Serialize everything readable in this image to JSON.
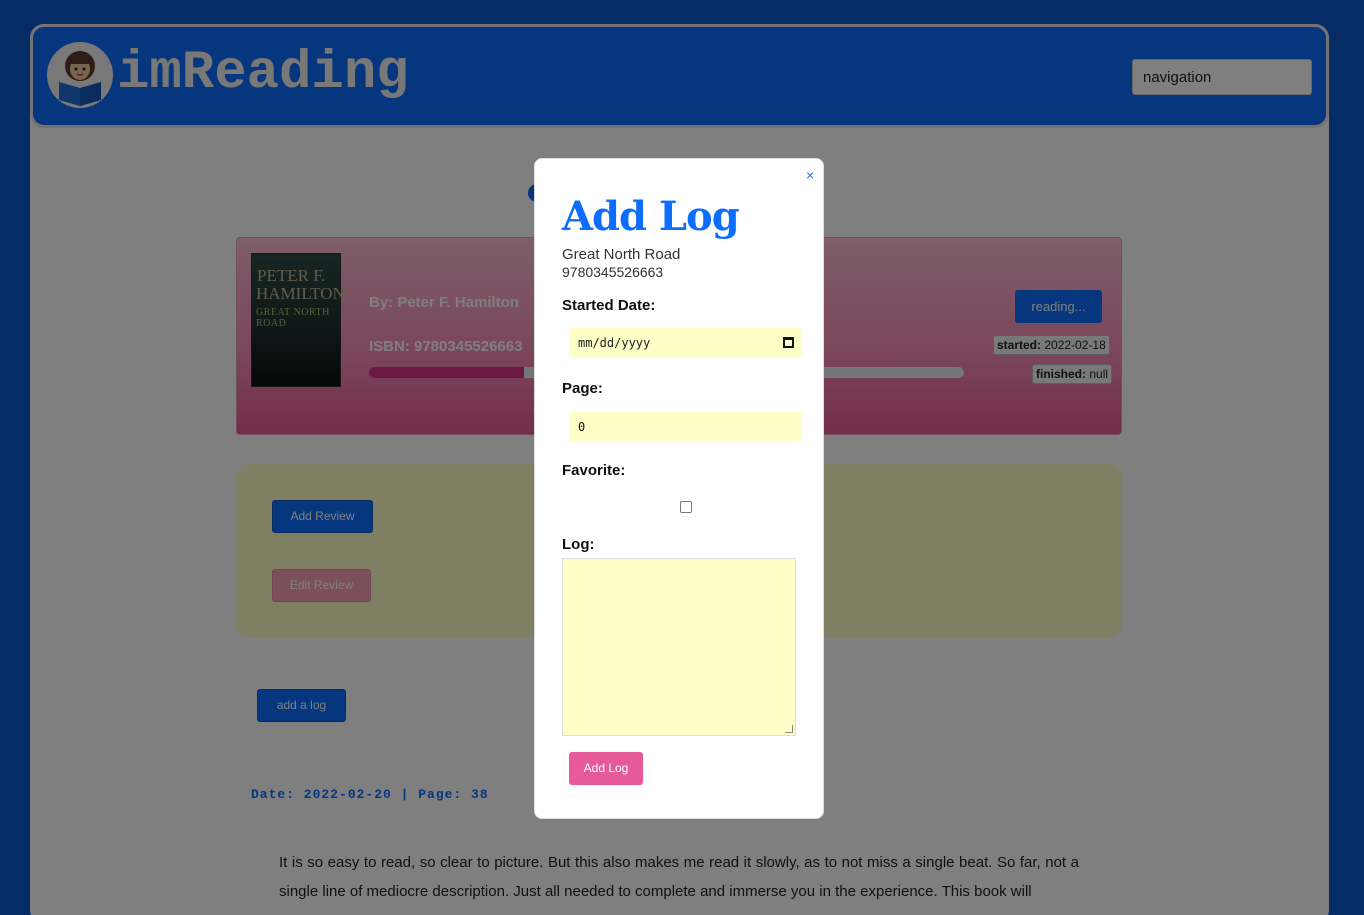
{
  "app": {
    "brand": "imReading",
    "nav_placeholder": "navigation"
  },
  "book": {
    "cover": {
      "line1": "PETER F.",
      "line2": "HAMILTON",
      "line3": "GREAT NORTH ROAD"
    },
    "author": "By: Peter F. Hamilton",
    "isbn": "ISBN: 9780345526663",
    "progress_percent": 26,
    "status_label": "reading...",
    "started_label": "started:",
    "started_value": "2022-02-18",
    "finished_label": "finished:",
    "finished_value": "null"
  },
  "review": {
    "add_label": "Add Review",
    "edit_label": "Edit Review"
  },
  "log_section": {
    "add_button": "add a log",
    "entry_meta": "Date: 2022-02-20 | Page: 38",
    "entry_text": "It is so easy to read, so clear to picture. But this also makes me read it slowly, as to not miss a single beat. So far, not a single line of mediocre description. Just all needed to complete and immerse you in the experience. This book will"
  },
  "modal": {
    "close": "×",
    "title": "Add Log",
    "book_title": "Great North Road",
    "book_isbn": "9780345526663",
    "started_label": "Started Date:",
    "date_placeholder": "mm/dd/yyyy",
    "page_label": "Page:",
    "page_value": "0",
    "favorite_label": "Favorite:",
    "log_label": "Log:",
    "submit_label": "Add Log"
  },
  "colors": {
    "primary": "#0d6efd",
    "pink": "#e75a9a",
    "field_bg": "#fffec7"
  }
}
